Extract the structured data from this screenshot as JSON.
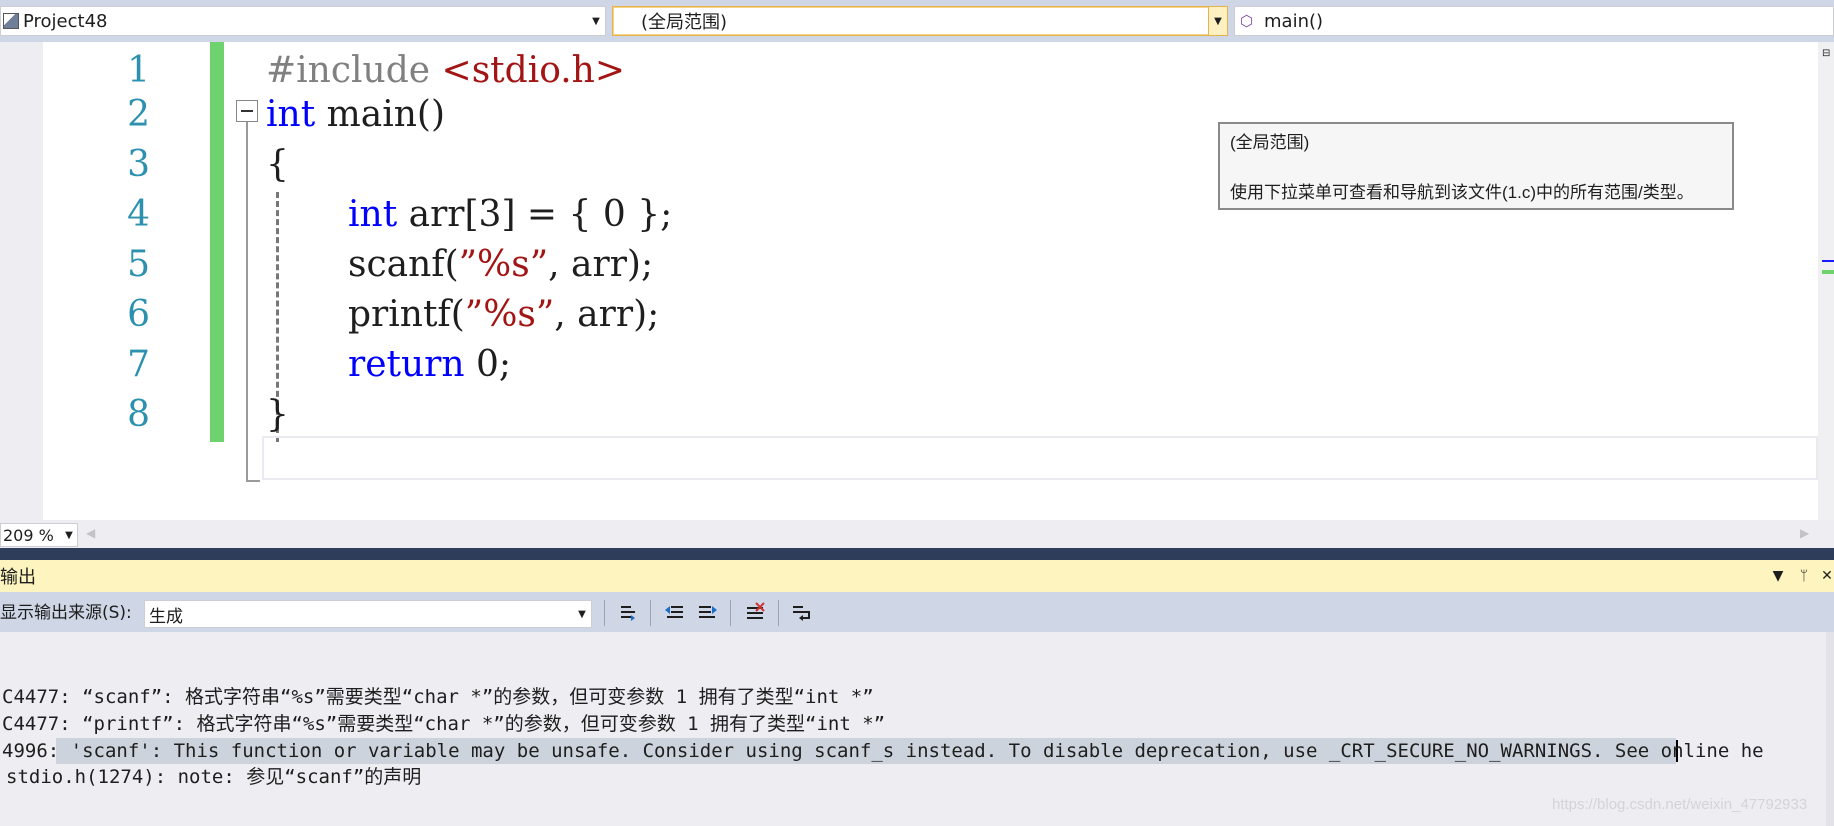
{
  "navbar": {
    "project": "Project48",
    "scope": "(全局范围)",
    "member": "main()"
  },
  "editor": {
    "line_numbers": [
      "1",
      "2",
      "3",
      "4",
      "5",
      "6",
      "7",
      "8"
    ],
    "code": {
      "l1_pp": "#include ",
      "l1_str": "<stdio.h>",
      "l2_kw": "int",
      "l2_rest": " main()",
      "l3": "{",
      "l4_kw": "int",
      "l4_rest": " arr[3] = { 0 };",
      "l5_a": "scanf(",
      "l5_str": "”%s”",
      "l5_b": ", arr);",
      "l6_a": "printf(",
      "l6_str": "”%s”",
      "l6_b": ", arr);",
      "l7_kw": "return",
      "l7_rest": " 0;",
      "l8": "}"
    },
    "tooltip": {
      "title": "(全局范围)",
      "description": "使用下拉菜单可查看和导航到该文件(1.c)中的所有范围/类型。"
    },
    "zoom": "209 %"
  },
  "output": {
    "title": "输出",
    "source_label": "显示输出来源(S):",
    "source_value": "生成",
    "lines": [
      "C4477: “scanf”: 格式字符串“%s”需要类型“char *”的参数，但可变参数 1 拥有了类型“int *”",
      "C4477: “printf”: 格式字符串“%s”需要类型“char *”的参数，但可变参数 1 拥有了类型“int *”",
      "4996: 'scanf': This function or variable may be unsafe. Consider using scanf_s instead. To disable deprecation, use _CRT_SECURE_NO_WARNINGS. See online he",
      "stdio.h(1274): note: 参见“scanf”的声明"
    ],
    "watermark": "https://blog.csdn.net/weixin_47792933"
  }
}
